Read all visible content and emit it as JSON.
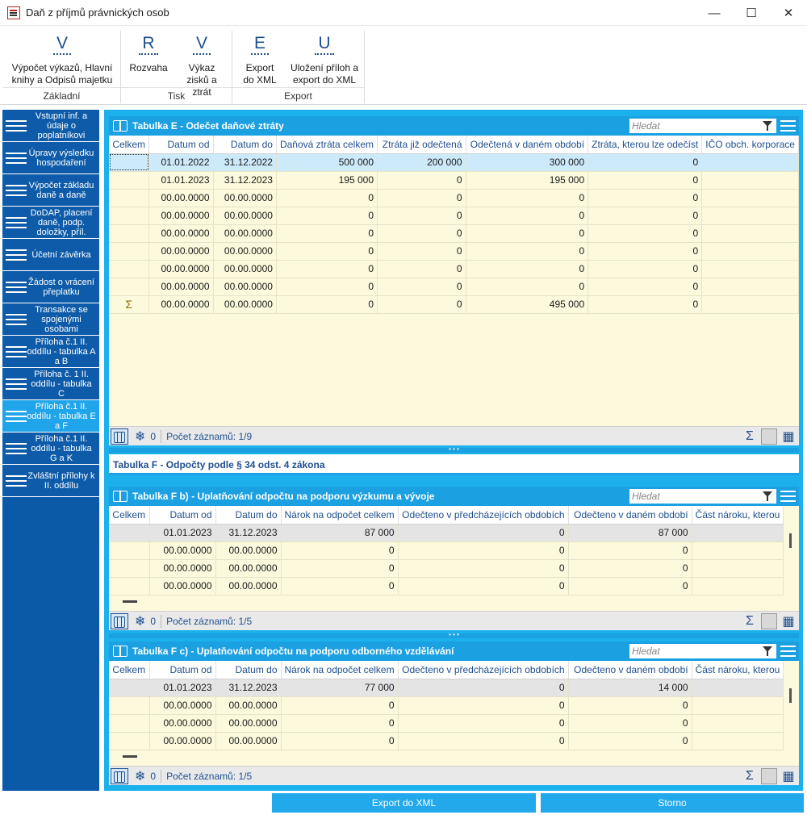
{
  "window": {
    "title": "Daň z příjmů právnických osob"
  },
  "ribbon": {
    "groups": [
      {
        "label": "Základní",
        "buttons": [
          {
            "letter": "V",
            "label": "Výpočet výkazů, Hlavní knihy a Odpisů majetku"
          }
        ]
      },
      {
        "label": "Tisk",
        "buttons": [
          {
            "letter": "R",
            "label": "Rozvaha"
          },
          {
            "letter": "V",
            "label": "Výkaz zisků a ztrát"
          }
        ]
      },
      {
        "label": "Export",
        "buttons": [
          {
            "letter": "E",
            "label": "Export do XML"
          },
          {
            "letter": "U",
            "label": "Uložení příloh a export do XML"
          }
        ]
      }
    ]
  },
  "sidebar": {
    "items": [
      {
        "label": "Vstupní inf. a údaje o poplatníkovi"
      },
      {
        "label": "Úpravy výsledku hospodaření"
      },
      {
        "label": "Výpočet základu daně a daně"
      },
      {
        "label": "DoDAP, placení daně, podp. doložky, příl."
      },
      {
        "label": "Účetní závěrka"
      },
      {
        "label": "Žádost o vrácení přeplatku"
      },
      {
        "label": "Transakce se spojenými osobami"
      },
      {
        "label": "Příloha č.1 II. oddílu - tabulka A a B"
      },
      {
        "label": "Příloha č. 1 II. oddílu - tabulka C"
      },
      {
        "label": "Příloha č.1 II. oddílu - tabulka E a F",
        "active": true
      },
      {
        "label": "Příloha č.1 II. oddílu - tabulka G a K"
      },
      {
        "label": "Zvláštní přílohy k II. oddílu"
      }
    ]
  },
  "tableE": {
    "title": "Tabulka E - Odečet daňové ztráty",
    "search_placeholder": "Hledat",
    "columns": [
      "Celkem",
      "Datum od",
      "Datum do",
      "Daňová ztráta celkem",
      "Ztráta již odečtená",
      "Odečtená v daném období",
      "Ztráta, kterou lze odečíst",
      "IČO obch. korporace"
    ],
    "rows": [
      [
        "",
        "01.01.2022",
        "31.12.2022",
        "500 000",
        "200 000",
        "300 000",
        "0",
        ""
      ],
      [
        "",
        "01.01.2023",
        "31.12.2023",
        "195 000",
        "0",
        "195 000",
        "0",
        ""
      ],
      [
        "",
        "00.00.0000",
        "00.00.0000",
        "0",
        "0",
        "0",
        "0",
        ""
      ],
      [
        "",
        "00.00.0000",
        "00.00.0000",
        "0",
        "0",
        "0",
        "0",
        ""
      ],
      [
        "",
        "00.00.0000",
        "00.00.0000",
        "0",
        "0",
        "0",
        "0",
        ""
      ],
      [
        "",
        "00.00.0000",
        "00.00.0000",
        "0",
        "0",
        "0",
        "0",
        ""
      ],
      [
        "",
        "00.00.0000",
        "00.00.0000",
        "0",
        "0",
        "0",
        "0",
        ""
      ],
      [
        "",
        "00.00.0000",
        "00.00.0000",
        "0",
        "0",
        "0",
        "0",
        ""
      ],
      [
        "Σ",
        "00.00.0000",
        "00.00.0000",
        "0",
        "0",
        "495 000",
        "0",
        ""
      ]
    ],
    "footer": {
      "count": "0",
      "records": "Počet záznamů: 1/9"
    }
  },
  "sectionF": {
    "title": "Tabulka F - Odpočty podle § 34 odst. 4 zákona"
  },
  "tableFb": {
    "title": "Tabulka F b) - Uplatňování odpočtu na podporu výzkumu a vývoje",
    "search_placeholder": "Hledat",
    "columns": [
      "Celkem",
      "Datum od",
      "Datum do",
      "Nárok na odpočet celkem",
      "Odečteno v předcházejících obdobích",
      "Odečteno v daném období",
      "Část nároku, kterou"
    ],
    "rows": [
      [
        "",
        "01.01.2023",
        "31.12.2023",
        "87 000",
        "0",
        "87 000",
        ""
      ],
      [
        "",
        "00.00.0000",
        "00.00.0000",
        "0",
        "0",
        "0",
        ""
      ],
      [
        "",
        "00.00.0000",
        "00.00.0000",
        "0",
        "0",
        "0",
        ""
      ],
      [
        "",
        "00.00.0000",
        "00.00.0000",
        "0",
        "0",
        "0",
        ""
      ]
    ],
    "footer": {
      "count": "0",
      "records": "Počet záznamů: 1/5"
    }
  },
  "tableFc": {
    "title": "Tabulka F c) - Uplatňování odpočtu na podporu odborného vzdělávání",
    "search_placeholder": "Hledat",
    "columns": [
      "Celkem",
      "Datum od",
      "Datum do",
      "Nárok na odpočet celkem",
      "Odečteno v předcházejících obdobích",
      "Odečteno v daném období",
      "Část nároku, kterou"
    ],
    "rows": [
      [
        "",
        "01.01.2023",
        "31.12.2023",
        "77 000",
        "0",
        "14 000",
        ""
      ],
      [
        "",
        "00.00.0000",
        "00.00.0000",
        "0",
        "0",
        "0",
        ""
      ],
      [
        "",
        "00.00.0000",
        "00.00.0000",
        "0",
        "0",
        "0",
        ""
      ],
      [
        "",
        "00.00.0000",
        "00.00.0000",
        "0",
        "0",
        "0",
        ""
      ]
    ],
    "footer": {
      "count": "0",
      "records": "Počet záznamů: 1/5"
    }
  },
  "actions": {
    "export": "Export do XML",
    "cancel": "Storno"
  }
}
